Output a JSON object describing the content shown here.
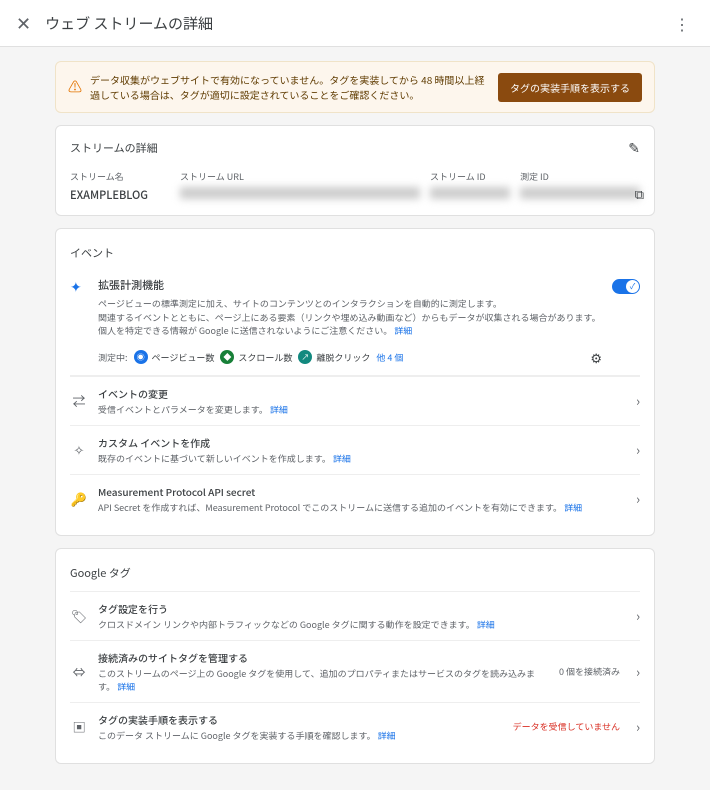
{
  "header": {
    "title": "ウェブ ストリームの詳細"
  },
  "alert": {
    "text": "データ収集がウェブサイトで有効になっていません。タグを実装してから 48 時間以上経過している場合は、タグが適切に設定されていることをご確認ください。",
    "button": "タグの実装手順を表示する"
  },
  "details": {
    "heading": "ストリームの詳細",
    "name_label": "ストリーム名",
    "name_value": "EXAMPLEBLOG",
    "url_label": "ストリーム URL",
    "id_label": "ストリーム ID",
    "meas_label": "測定 ID"
  },
  "events": {
    "heading": "イベント",
    "enhanced": {
      "title": "拡張計測機能",
      "desc1": "ページビューの標準測定に加え、サイトのコンテンツとのインタラクションを自動的に測定します。",
      "desc2": "関連するイベントとともに、ページ上にある要素（リンクや埋め込み動画など）からもデータが収集される場合があります。個人を特定できる情報が Google に送信されないようにご注意ください。",
      "detail_link": "詳細",
      "measuring_label": "測定中:",
      "chip1": "ページビュー数",
      "chip2": "スクロール数",
      "chip3": "離脱クリック",
      "more": "他 4 個"
    },
    "modify": {
      "title": "イベントの変更",
      "desc": "受信イベントとパラメータを変更します。",
      "link": "詳細"
    },
    "custom": {
      "title": "カスタム イベントを作成",
      "desc": "既存のイベントに基づいて新しいイベントを作成します。",
      "link": "詳細"
    },
    "api": {
      "title": "Measurement Protocol API secret",
      "desc": "API Secret を作成すれば、Measurement Protocol でこのストリームに送信する追加のイベントを有効にできます。",
      "link": "詳細"
    }
  },
  "gtag": {
    "heading": "Google タグ",
    "config": {
      "title": "タグ設定を行う",
      "desc": "クロスドメイン リンクや内部トラフィックなどの Google タグに関する動作を設定できます。",
      "link": "詳細"
    },
    "connected": {
      "title": "接続済みのサイトタグを管理する",
      "desc": "このストリームのページ上の Google タグを使用して、追加のプロパティまたはサービスのタグを読み込みます。",
      "link": "詳細",
      "count": "0 個を接続済み"
    },
    "install": {
      "title": "タグの実装手順を表示する",
      "desc": "このデータ ストリームに Google タグを実装する手順を確認します。",
      "link": "詳細",
      "warning": "データを受信していません"
    }
  }
}
